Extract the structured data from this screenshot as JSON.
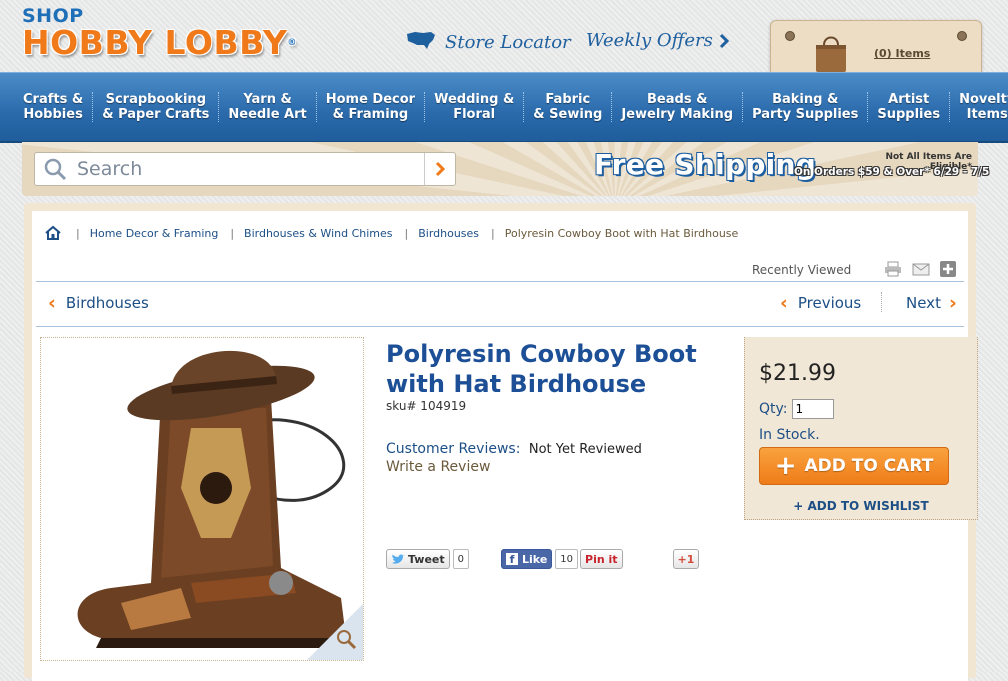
{
  "header": {
    "logo_top": "SHOP",
    "logo_main": "HOBBY LOBBY",
    "logo_reg": "®",
    "store_locator": "Store Locator",
    "weekly_offers": "Weekly Offers",
    "cart_items": "(0) Items"
  },
  "nav": {
    "items": [
      {
        "line1": "Crafts &",
        "line2": "Hobbies"
      },
      {
        "line1": "Scrapbooking",
        "line2": "& Paper Crafts"
      },
      {
        "line1": "Yarn &",
        "line2": "Needle Art"
      },
      {
        "line1": "Home Decor",
        "line2": "& Framing"
      },
      {
        "line1": "Wedding &",
        "line2": "Floral"
      },
      {
        "line1": "Fabric",
        "line2": "& Sewing"
      },
      {
        "line1": "Beads &",
        "line2": "Jewelry Making"
      },
      {
        "line1": "Baking &",
        "line2": "Party Supplies"
      },
      {
        "line1": "Artist",
        "line2": "Supplies"
      },
      {
        "line1": "Novelty",
        "line2": "Items"
      }
    ]
  },
  "search": {
    "placeholder": "Search"
  },
  "promo": {
    "title": "Free Shipping",
    "note": "Not All Items Are Eligible*",
    "sub": "On Orders $59 & Over* 6/29 - 7/5"
  },
  "breadcrumb": {
    "items": [
      "Home Decor & Framing",
      "Birdhouses & Wind Chimes",
      "Birdhouses"
    ],
    "current": "Polyresin Cowboy Boot with Hat Birdhouse"
  },
  "toolbar": {
    "recently_viewed": "Recently Viewed"
  },
  "pager": {
    "back": "Birdhouses",
    "previous": "Previous",
    "next": "Next"
  },
  "product": {
    "title_line1": "Polyresin Cowboy Boot",
    "title_line2": "with Hat Birdhouse",
    "sku": "sku# 104919",
    "reviews_label": "Customer Reviews:",
    "reviews_value": "Not Yet Reviewed",
    "write_review": "Write a Review"
  },
  "social": {
    "tweet": "Tweet",
    "tweet_count": "0",
    "like": "Like",
    "like_count": "10",
    "pin": "Pin it",
    "gplus": "+1"
  },
  "buy": {
    "price": "$21.99",
    "qty_label": "Qty:",
    "qty_value": "1",
    "stock": "In Stock.",
    "add_to_cart": "ADD TO CART",
    "wishlist": "+ ADD TO WISHLIST"
  },
  "colors": {
    "brand_orange": "#f07a1a",
    "brand_blue": "#1e6fb8",
    "nav_blue": "#2a6aab",
    "link_blue": "#1c4f86"
  }
}
